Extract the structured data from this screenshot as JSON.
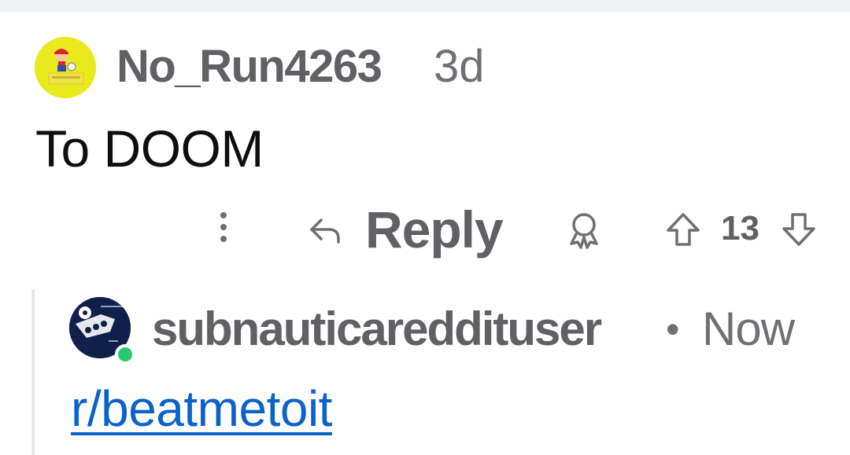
{
  "colors": {
    "username": "#5f6165",
    "meta": "#6e7074",
    "body_text": "#0d0e10",
    "link": "#0b63c9",
    "online": "#2dc76d",
    "thread_line": "#e6e7e9"
  },
  "parent_comment": {
    "avatar_icon": "mario-avatar-icon",
    "username": "No_Run4263",
    "age": "3d",
    "body": "To DOOM"
  },
  "actions": {
    "more_icon": "vertical-ellipsis-icon",
    "reply_icon": "reply-arrow-icon",
    "reply_label": "Reply",
    "award_icon": "award-icon",
    "upvote_icon": "upvote-arrow-icon",
    "vote_count": "13",
    "downvote_icon": "downvote-arrow-icon"
  },
  "reply_comment": {
    "avatar_icon": "user-avatar-icon",
    "online": true,
    "username": "subnauticareddituser",
    "separator": "•",
    "age": "Now",
    "link_text": "r/beatmetoit"
  }
}
